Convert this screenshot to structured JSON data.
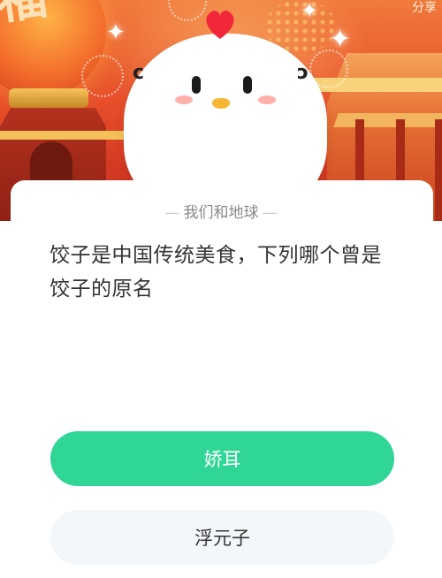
{
  "banner": {
    "lantern_char": "福",
    "corner_text": "分享"
  },
  "quiz": {
    "source": "我们和地球",
    "question": "饺子是中国传统美食，下列哪个曾是饺子的原名",
    "options": [
      {
        "label": "娇耳",
        "state": "selected"
      },
      {
        "label": "浮元子",
        "state": "default"
      }
    ]
  },
  "colors": {
    "accent_green": "#2fd696",
    "banner_red": "#d33a22",
    "option_default_bg": "#f4f7fa",
    "question_text": "#333333",
    "source_text": "#888888"
  },
  "icons": {
    "mascot": "chicken-mascot-icon",
    "sparkle": "sparkle-icon"
  }
}
